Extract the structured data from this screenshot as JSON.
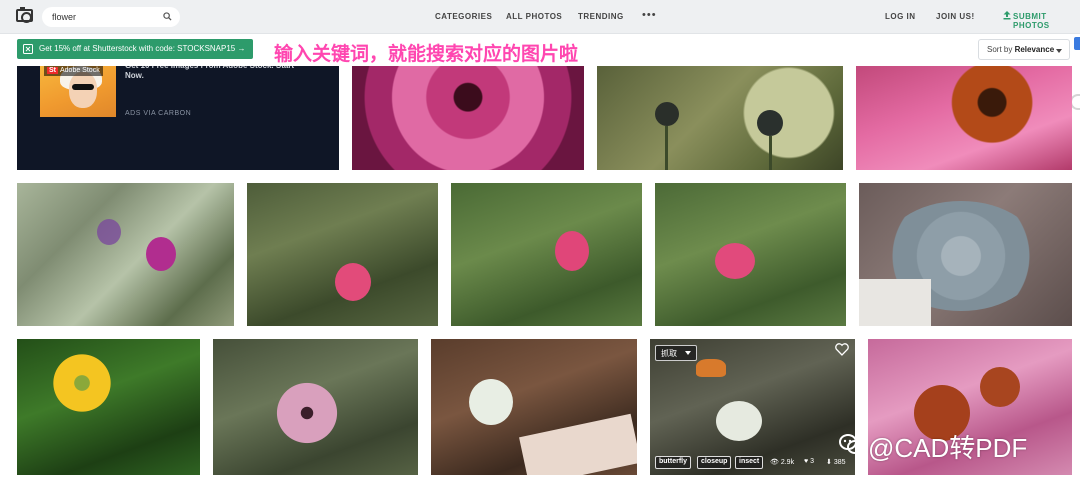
{
  "search": {
    "value": "flower"
  },
  "nav": {
    "categories": "CATEGORIES",
    "all_photos": "ALL PHOTOS",
    "trending": "TRENDING",
    "more": "•••",
    "log_in": "LOG IN",
    "join_us": "JOIN US!",
    "submit_photos": "SUBMIT PHOTOS"
  },
  "promo": {
    "text": "Get 15% off at Shutterstock with code: STOCKSNAP15 →"
  },
  "annotation": {
    "text": "输入关键词，就能搜索对应的图片啦"
  },
  "sort": {
    "label": "Sort by",
    "value": "Relevance"
  },
  "ad": {
    "badge": "Adobe Stock",
    "badge_mark": "St",
    "title": "Get 10 Free Images From Adobe Stock. Start Now.",
    "via": "ADS VIA CARBON"
  },
  "photo_overlay": {
    "capture_label": "抓取",
    "tags": [
      "butterfly",
      "closeup",
      "insect"
    ],
    "views": "2.9k",
    "likes": "3",
    "downloads": "385"
  },
  "watermark": {
    "text": "@CAD转PDF"
  },
  "photos": [
    {
      "name": "photo-pink-dahlia",
      "subject": "pink dahlia"
    },
    {
      "name": "photo-anemone-buds",
      "subject": "anemone buds"
    },
    {
      "name": "photo-coneflower-bee",
      "subject": "coneflower with bee"
    },
    {
      "name": "photo-wild-geranium",
      "subject": "wild geranium"
    },
    {
      "name": "photo-pink-bud-1",
      "subject": "pink bud"
    },
    {
      "name": "photo-pink-bud-2",
      "subject": "pink bud"
    },
    {
      "name": "photo-pink-bud-3",
      "subject": "pink bud"
    },
    {
      "name": "photo-succulent",
      "subject": "succulent"
    },
    {
      "name": "photo-buttercup",
      "subject": "yellow buttercup"
    },
    {
      "name": "photo-anemone",
      "subject": "pink anemone"
    },
    {
      "name": "photo-bouquet-vase",
      "subject": "bouquet in vase"
    },
    {
      "name": "photo-butterfly-flowers",
      "subject": "butterfly and flowers"
    },
    {
      "name": "photo-coneflowers",
      "subject": "coneflowers"
    }
  ],
  "colors": {
    "accent": "#2d9b6b",
    "annotation": "#ff46b0",
    "ad_background": "#0f1626"
  }
}
